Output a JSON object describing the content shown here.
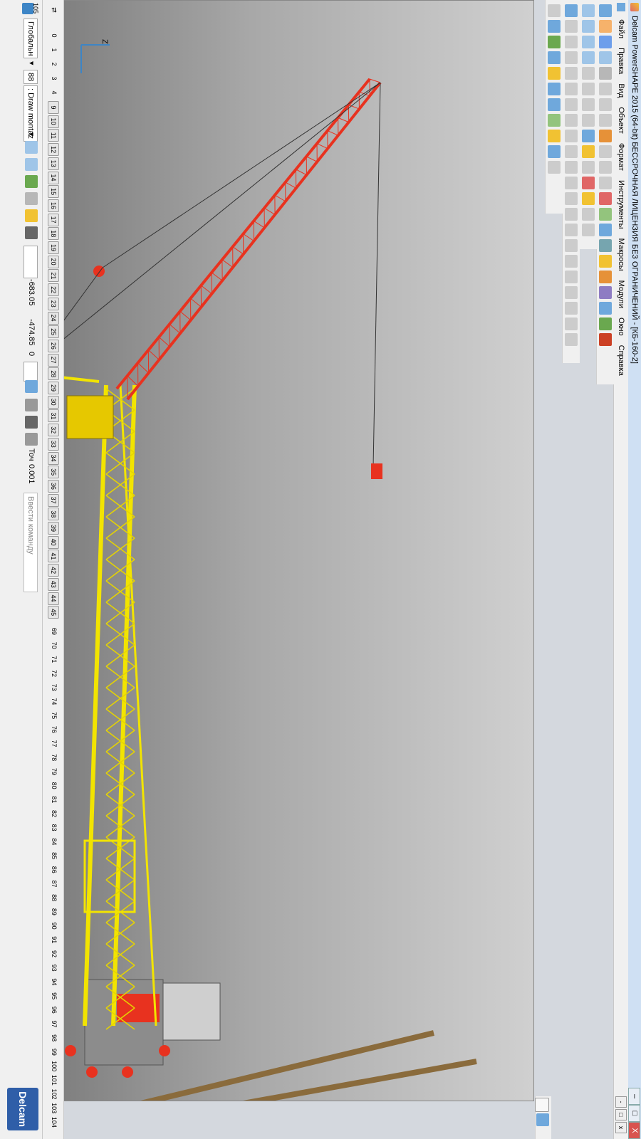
{
  "window": {
    "title": "Delcam PowerSHAPE 2015 (64-bit) БЕССРОЧНАЯ ЛИЦЕНЗИЯ БЕЗ ОГРАНИЧЕНИЙ - [КБ-160-2]",
    "minimize": "–",
    "restore": "□",
    "close": "X"
  },
  "menubar": {
    "items": [
      "Файл",
      "Правка",
      "Вид",
      "Объект",
      "Формат",
      "Инструменты",
      "Макросы",
      "Модули",
      "Окно",
      "Справка"
    ],
    "mdi_buttons": [
      "-",
      "□",
      "x"
    ]
  },
  "statusbar": {
    "top_number": "105",
    "workplane": "Глобальн",
    "level_number": "88",
    "level_name": ": Draw montaz",
    "coord_x": "-683.05",
    "coord_y": "-474.85",
    "coord_z": "0",
    "snap_label": "Точ",
    "tolerance": "0.001",
    "command_placeholder": "Ввести команду",
    "logo": "Delcam"
  },
  "levels": {
    "plain": [
      "0",
      "1",
      "2",
      "3",
      "4"
    ],
    "boxed": [
      "9",
      "10",
      "11",
      "12",
      "13",
      "14",
      "15",
      "16",
      "17",
      "18",
      "19",
      "20",
      "21",
      "22",
      "23",
      "24",
      "25",
      "26",
      "27",
      "28",
      "29",
      "30",
      "31",
      "32",
      "33",
      "34",
      "35",
      "36",
      "37",
      "38",
      "39",
      "40",
      "41",
      "42",
      "43",
      "44",
      "45"
    ],
    "tail": [
      "69",
      "70",
      "71",
      "72",
      "73",
      "74",
      "75",
      "76",
      "77",
      "78",
      "79",
      "80",
      "81",
      "82",
      "83",
      "84",
      "85",
      "86",
      "87",
      "88",
      "89",
      "90",
      "91",
      "92",
      "93",
      "94",
      "95",
      "96",
      "97",
      "98",
      "99",
      "100",
      "101",
      "102",
      "103",
      "104"
    ]
  },
  "axis": {
    "label": "Z"
  },
  "colors": {
    "tower": "#f2e400",
    "boom": "#e8321f",
    "hook": "#e8321f",
    "rail": "#8a6b3c",
    "viewport_top": "#d0d0d0",
    "viewport_bottom": "#808080"
  }
}
